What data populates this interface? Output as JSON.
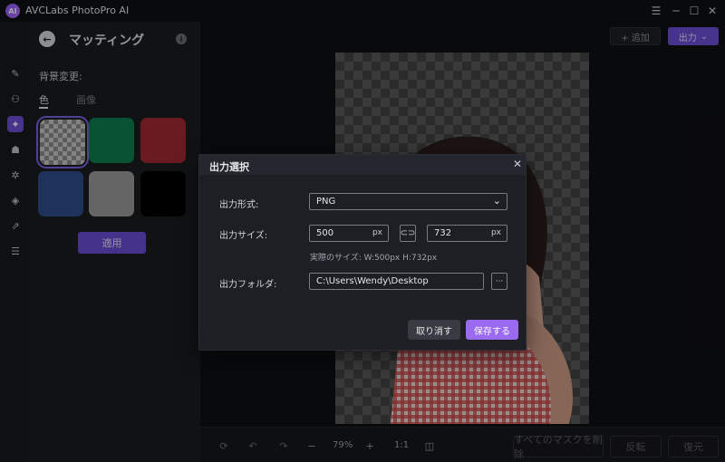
{
  "app": {
    "title": "AVCLabs PhotoPro AI",
    "logo_text": "AI"
  },
  "window_controls": {
    "menu": "☰",
    "minimize": "─",
    "maximize": "☐",
    "close": "✕"
  },
  "side_panel": {
    "title": "マッティング",
    "background_change_label": "背景変更:",
    "tabs": {
      "color": "色",
      "image": "画像"
    },
    "swatches": [
      "transparent",
      "#0f8050",
      "#a42a33",
      "#2f4e8c",
      "#9b9b9b",
      "#000000"
    ],
    "apply_label": "適用"
  },
  "top_actions": {
    "add_label": "+ 追加",
    "export_label": "出力"
  },
  "bottom_toolbar": {
    "zoom": "79%",
    "ratio": "1:1",
    "remove_all_masks": "すべてのマスクを削除",
    "flip": "反転",
    "restore": "復元"
  },
  "dialog": {
    "title": "出力選択",
    "format_label": "出力形式:",
    "format_value": "PNG",
    "size_label": "出力サイズ:",
    "width_value": "500",
    "height_value": "732",
    "unit": "px",
    "actual_size": "実際のサイズ:   W:500px   H:732px",
    "folder_label": "出力フォルダ:",
    "folder_value": "C:\\Users\\Wendy\\Desktop",
    "browse_label": "···",
    "cancel_label": "取り消す",
    "save_label": "保存する"
  },
  "colors": {
    "accent": "#6a4fd8",
    "save_button": "#9a6af0"
  }
}
